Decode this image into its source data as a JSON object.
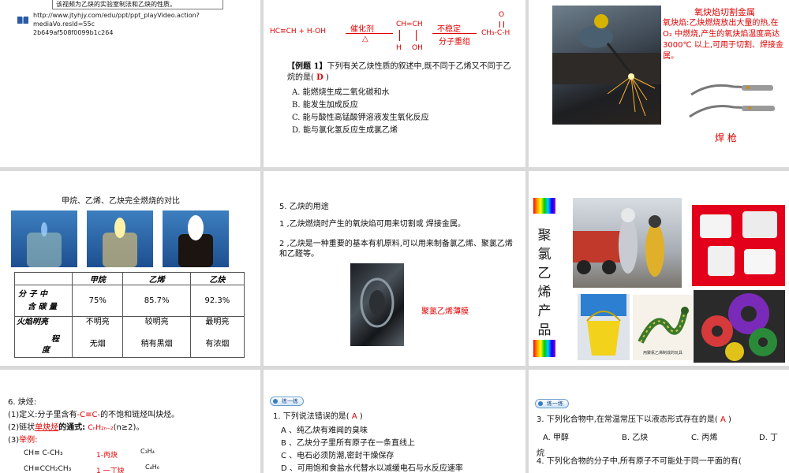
{
  "s1": {
    "note": "该视频为乙炔的实验室制法和乙炔的性质。",
    "url_line1": "http://www.jtyhjy.com/edu/ppt/ppt_playVideo.action?mediaVo.resId=55c",
    "url_line2": "2b649af508f0099b1c264"
  },
  "s2": {
    "reactant": "HC≡CH  +  H-OH",
    "catalyst": "催化剂",
    "heat": "△",
    "intermediate_top": "CH=CH",
    "intermediate_h": "H",
    "intermediate_oh": "OH",
    "unstable": "不稳定",
    "rearrange": "分子重组",
    "product_o": "O",
    "product": "CH₃-C-H",
    "example_label": "【例题 1】",
    "question": "下列有关乙炔性质的叙述中,既不同于乙烯又不同于乙烷的是(",
    "answer": "D",
    "question_end": ")",
    "options": [
      "A. 能燃烧生成二氧化碳和水",
      "B. 能发生加成反应",
      "C. 能与酸性高锰酸钾溶液发生氧化反应",
      "D. 能与氯化氢反应生成氯乙烯"
    ]
  },
  "s3": {
    "title": "氧炔焰切割金属",
    "desc": "氧炔焰:乙炔燃烧放出大量的热,在 O₂ 中燃烧,产生的氧炔焰温度高达 3000℃ 以上,可用于切割、焊接金属。",
    "torch_label": "焊 枪"
  },
  "s4": {
    "title": "甲烷、乙烯、乙炔完全燃烧的对比",
    "headers": [
      "",
      "甲烷",
      "乙烯",
      "乙炔"
    ],
    "row1_label_a": "分 子 中",
    "row1_label_b": "含 碳 量",
    "carbon": [
      "75%",
      "85.7%",
      "92.3%"
    ],
    "row2_label_a": "火焰明亮",
    "row2_label_b": "程",
    "row2_label_c": "度",
    "brightness": [
      "不明亮",
      "较明亮",
      "最明亮"
    ],
    "smoke": [
      "无烟",
      "稍有黑烟",
      "有浓烟"
    ]
  },
  "s5": {
    "title": "5. 乙炔的用途",
    "use1": "1 ,乙炔燃烧时产生的氧炔焰可用来切割或 焊接金属。",
    "use2": "2 ,乙炔是一种重要的基本有机原料,可以用来制备氯乙烯、聚氯乙烯和乙醛等。",
    "film_label": "聚氯乙烯薄膜"
  },
  "s6": {
    "vertical_title": [
      "聚",
      "氯",
      "乙",
      "烯",
      "产",
      "品"
    ],
    "caption": "用聚氯乙烯制成的玩具"
  },
  "s7": {
    "heading": "6.  炔烃:",
    "def_prefix": "(1)定义:分子里含有",
    "def_bond": "-C≡C-",
    "def_suffix": "的不饱和链烃叫炔烃。",
    "formula_prefix": "(2)链状",
    "formula_key": "单炔烃",
    "formula_mid": "的通式:",
    "formula_red": "CₙH₂ₙ₋₂",
    "formula_tail": "(n≥2)。",
    "examples_prefix": "(3)",
    "examples_label": "举例:",
    "ex1_formula": "CH≡ C-CH₃",
    "ex1_name": "1-丙炔",
    "ex1_mol": "C₃H₄",
    "ex2_formula": "CH≡CCH₂CH₃",
    "ex2_name": "1 一丁炔",
    "ex2_mol": "C₄H₆"
  },
  "s8": {
    "tag": "练一练",
    "q1_prefix": "1. 下列说法错误的是(",
    "q1_answer": "A",
    "q1_suffix": ")",
    "options": [
      "A  、纯乙炔有难闻的臭味",
      "B  、乙炔分子里所有原子在一条直线上",
      "C  、电石必须防潮,密封干燥保存",
      "D  、可用饱和食盐水代替水以减缓电石与水反应速率"
    ]
  },
  "s9": {
    "tag": "练一练",
    "q3_prefix": "3. 下列化合物中,在常温常压下以液态形式存在的是(",
    "q3_answer": "A",
    "q3_suffix": ")",
    "q3_options": [
      "A.  甲醇",
      "B.  乙炔",
      "C.  丙烯",
      "D.  丁"
    ],
    "q3_wrap": "烷",
    "q4": "4. 下列化合物的分子中,所有原子不可能处于同一平面的有("
  }
}
